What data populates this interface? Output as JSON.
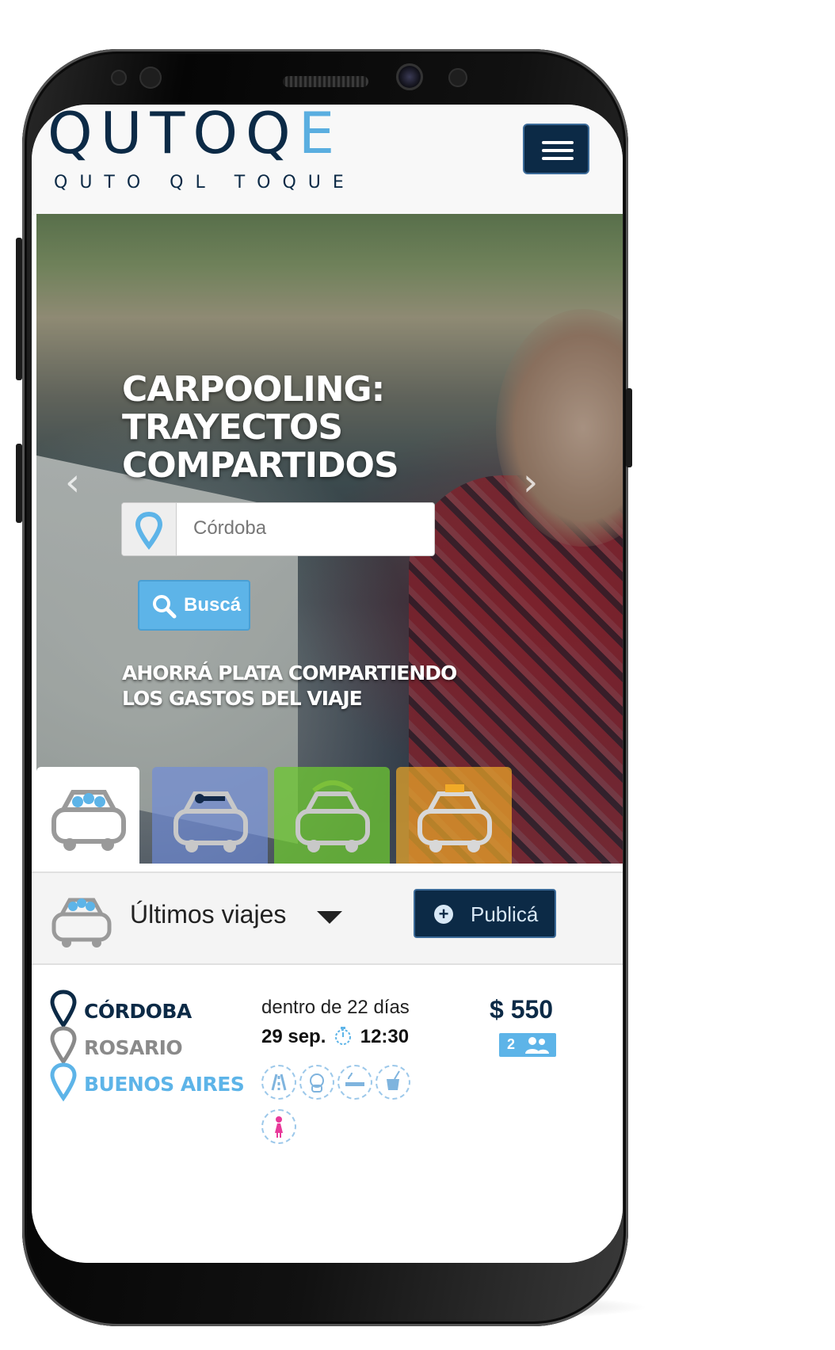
{
  "header": {
    "logo_main_prefix": "QUTOQ",
    "logo_main_suffix": "E",
    "logo_sub": "QUTO QL TOQUE"
  },
  "hero": {
    "title_lines": [
      "CARPOOLING:",
      "TRAYECTOS",
      "COMPARTIDOS"
    ],
    "search_value": "Córdoba",
    "search_button": "Buscá",
    "tagline_lines": [
      "AHORRÁ PLATA COMPARTIENDO",
      "LOS GASTOS DEL VIAJE"
    ],
    "prev_arrow": "‹",
    "next_arrow": "›"
  },
  "trips_bar": {
    "title": "Últimos viajes",
    "publish_label": "Publicá",
    "publish_symbol": "+"
  },
  "trip": {
    "origin": "CÓRDOBA",
    "stop": "ROSARIO",
    "destination": "BUENOS AIRES",
    "when": "dentro de 22 días",
    "date": "29 sep.",
    "time": "12:30",
    "price": "$ 550",
    "seats": "2"
  },
  "icons": {
    "menu": "hamburger-icon",
    "search_pin": "map-pin-icon",
    "search_button": "magnifier-icon",
    "clock": "stopwatch-icon",
    "seats": "people-icon",
    "features": [
      "highway-icon",
      "pet-icon",
      "smoking-icon",
      "mate-icon",
      "women-only-icon"
    ]
  },
  "colors": {
    "navy": "#0c2a46",
    "accent_blue": "#5db4e8",
    "stop_gray": "#8a8a8a",
    "women_pink": "#e8399a"
  }
}
